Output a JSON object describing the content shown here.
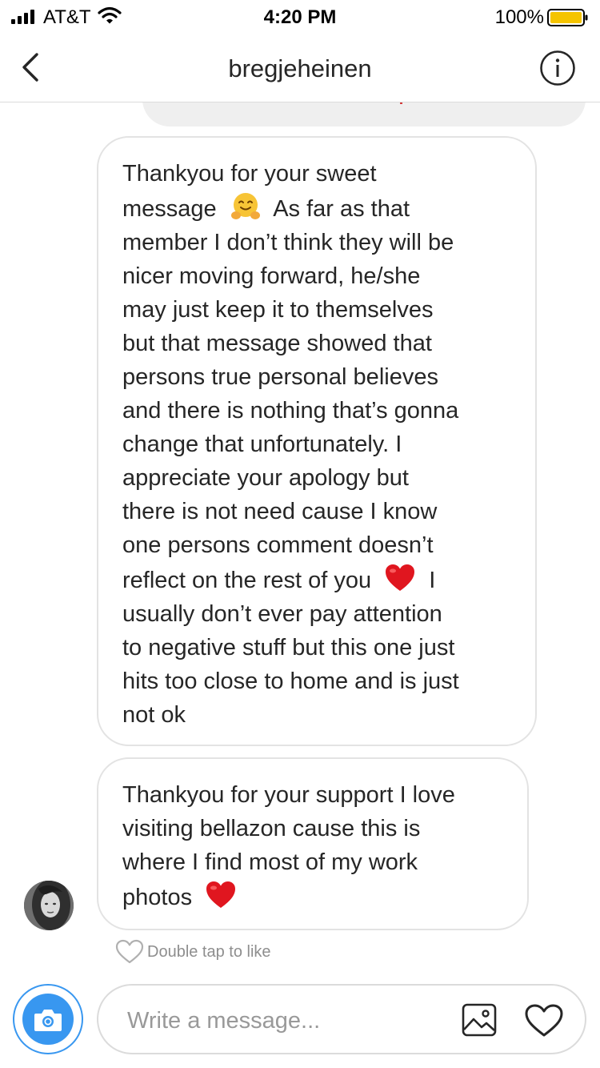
{
  "status_bar": {
    "carrier": "AT&T",
    "time": "4:20 PM",
    "battery_percent": "100%",
    "battery_color": "#f5c400"
  },
  "nav": {
    "title": "bregjeheinen",
    "back_icon": "chevron-left-icon",
    "info_icon": "info-icon"
  },
  "messages": [
    {
      "lines": [
        "Thankyou for your sweet",
        [
          "message ",
          "hugging-face-emoji",
          " As far as that"
        ],
        "member I don’t think they will be",
        "nicer moving forward, he/she",
        "may just keep it to themselves",
        "but that message showed that",
        "persons true personal believes",
        "and there is nothing that’s gonna",
        "change that unfortunately. I",
        "appreciate your apology but",
        "there is not need cause I know",
        "one persons comment doesn’t",
        [
          "reflect on the rest of you ",
          "red-heart-emoji",
          " I"
        ],
        "usually don’t ever pay attention",
        "to negative stuff but this one just",
        "hits too close to home and is just",
        "not ok"
      ]
    },
    {
      "lines": [
        "Thankyou for your support I love",
        "visiting bellazon cause this is",
        "where I find most of my work",
        [
          "photos ",
          "red-heart-emoji",
          ""
        ]
      ]
    }
  ],
  "like_hint": "Double tap to like",
  "composer": {
    "placeholder": "Write a message...",
    "camera_icon": "camera-icon",
    "gallery_icon": "gallery-icon",
    "heart_icon": "heart-icon",
    "accent_color": "#3897f0"
  }
}
